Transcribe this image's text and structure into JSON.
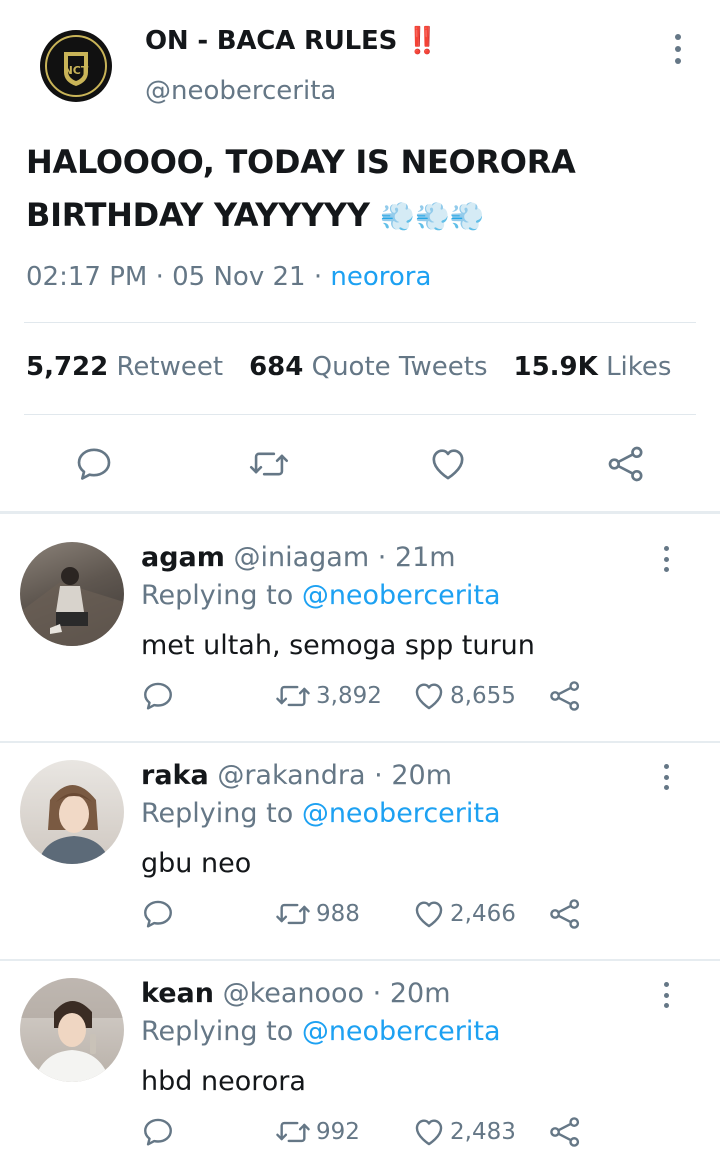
{
  "tweet": {
    "author_name": "ON - BACA RULES",
    "author_emoji": "‼️",
    "author_handle": "@neobercerita",
    "avatar_text": "NCT",
    "text": "HALOOOO, TODAY IS NEORORA BIRTHDAY YAYYYYY",
    "text_emoji": "💨💨💨",
    "time": "02:17 PM",
    "date": "05 Nov 21",
    "source": "neorora",
    "sep": "·",
    "retweets": "5,722",
    "retweets_label": "Retweet",
    "quotes": "684",
    "quotes_label": "Quote Tweets",
    "likes": "15.9K",
    "likes_label": "Likes"
  },
  "colors": {
    "accent": "#1da1f2",
    "muted": "#657786",
    "text": "#14171a",
    "badge": "#e0245e"
  },
  "icons": [
    "comment-icon",
    "retweet-icon",
    "heart-icon",
    "share-icon",
    "more-icon"
  ],
  "replies": [
    {
      "name": "agam",
      "handle": "@iniagam",
      "sep": "·",
      "time": "21m",
      "replying_label": "Replying to",
      "replying_to": "@neobercerita",
      "text": "met ultah, semoga spp turun",
      "retweets": "3,892",
      "likes": "8,655"
    },
    {
      "name": "raka",
      "handle": "@rakandra",
      "sep": "·",
      "time": "20m",
      "replying_label": "Replying to",
      "replying_to": "@neobercerita",
      "text": "gbu neo",
      "retweets": "988",
      "likes": "2,466"
    },
    {
      "name": "kean",
      "handle": "@keanooo",
      "sep": "·",
      "time": "20m",
      "replying_label": "Replying to",
      "replying_to": "@neobercerita",
      "text": "hbd neorora",
      "retweets": "992",
      "likes": "2,483"
    }
  ]
}
